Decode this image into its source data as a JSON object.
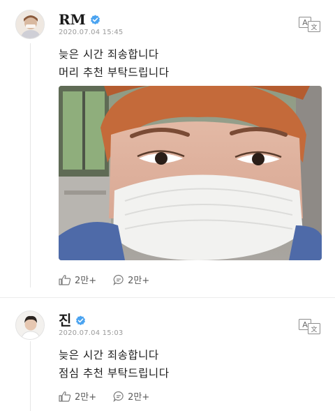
{
  "posts": [
    {
      "author": "RM",
      "timestamp": "2020.07.04 15:45",
      "lines": [
        "늦은 시간 죄송합니다",
        "머리 추천 부탁드립니다"
      ],
      "likes": "2만+",
      "comments": "2만+",
      "avatar_icon": "avatar-photo",
      "has_photo": true
    },
    {
      "author": "진",
      "timestamp": "2020.07.04 15:03",
      "lines": [
        "늦은 시간 죄송합니다",
        "점심 추천 부탁드립니다"
      ],
      "likes": "2만+",
      "comments": "2만+",
      "avatar_icon": "avatar-photo",
      "has_photo": false
    }
  ],
  "colors": {
    "verified": "#4aa3f0",
    "meta_text": "#9a9a9a",
    "action_text": "#5a5a5a",
    "thread_line": "#e6e6e6"
  },
  "icons": {
    "verified": "verified-check-icon",
    "translate": "translate-icon",
    "like": "like-hand-icon",
    "comment": "comment-bubble-icon"
  }
}
